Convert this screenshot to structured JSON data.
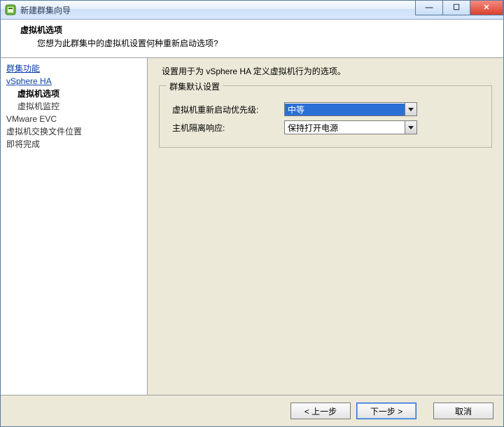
{
  "titlebar": {
    "title": "新建群集向导"
  },
  "header": {
    "title": "虚拟机选项",
    "subtitle": "您想为此群集中的虚拟机设置何种重新启动选项?"
  },
  "nav": {
    "items": [
      {
        "label": "群集功能",
        "kind": "link",
        "level": 1
      },
      {
        "label": "vSphere HA",
        "kind": "link",
        "level": 1
      },
      {
        "label": "虚拟机选项",
        "kind": "current",
        "level": 2
      },
      {
        "label": "虚拟机监控",
        "kind": "plain",
        "level": 2
      },
      {
        "label": "VMware EVC",
        "kind": "plain",
        "level": 1
      },
      {
        "label": "虚拟机交换文件位置",
        "kind": "plain",
        "level": 1
      },
      {
        "label": "即将完成",
        "kind": "plain",
        "level": 1
      }
    ]
  },
  "content": {
    "description": "设置用于为 vSphere HA 定义虚拟机行为的选项。",
    "fieldset_title": "群集默认设置",
    "row1_label": "虚拟机重新启动优先级:",
    "row1_value": "中等",
    "row2_label": "主机隔离响应:",
    "row2_value": "保持打开电源"
  },
  "footer": {
    "back": "< 上一步",
    "next": "下一步 >",
    "cancel": "取消"
  }
}
